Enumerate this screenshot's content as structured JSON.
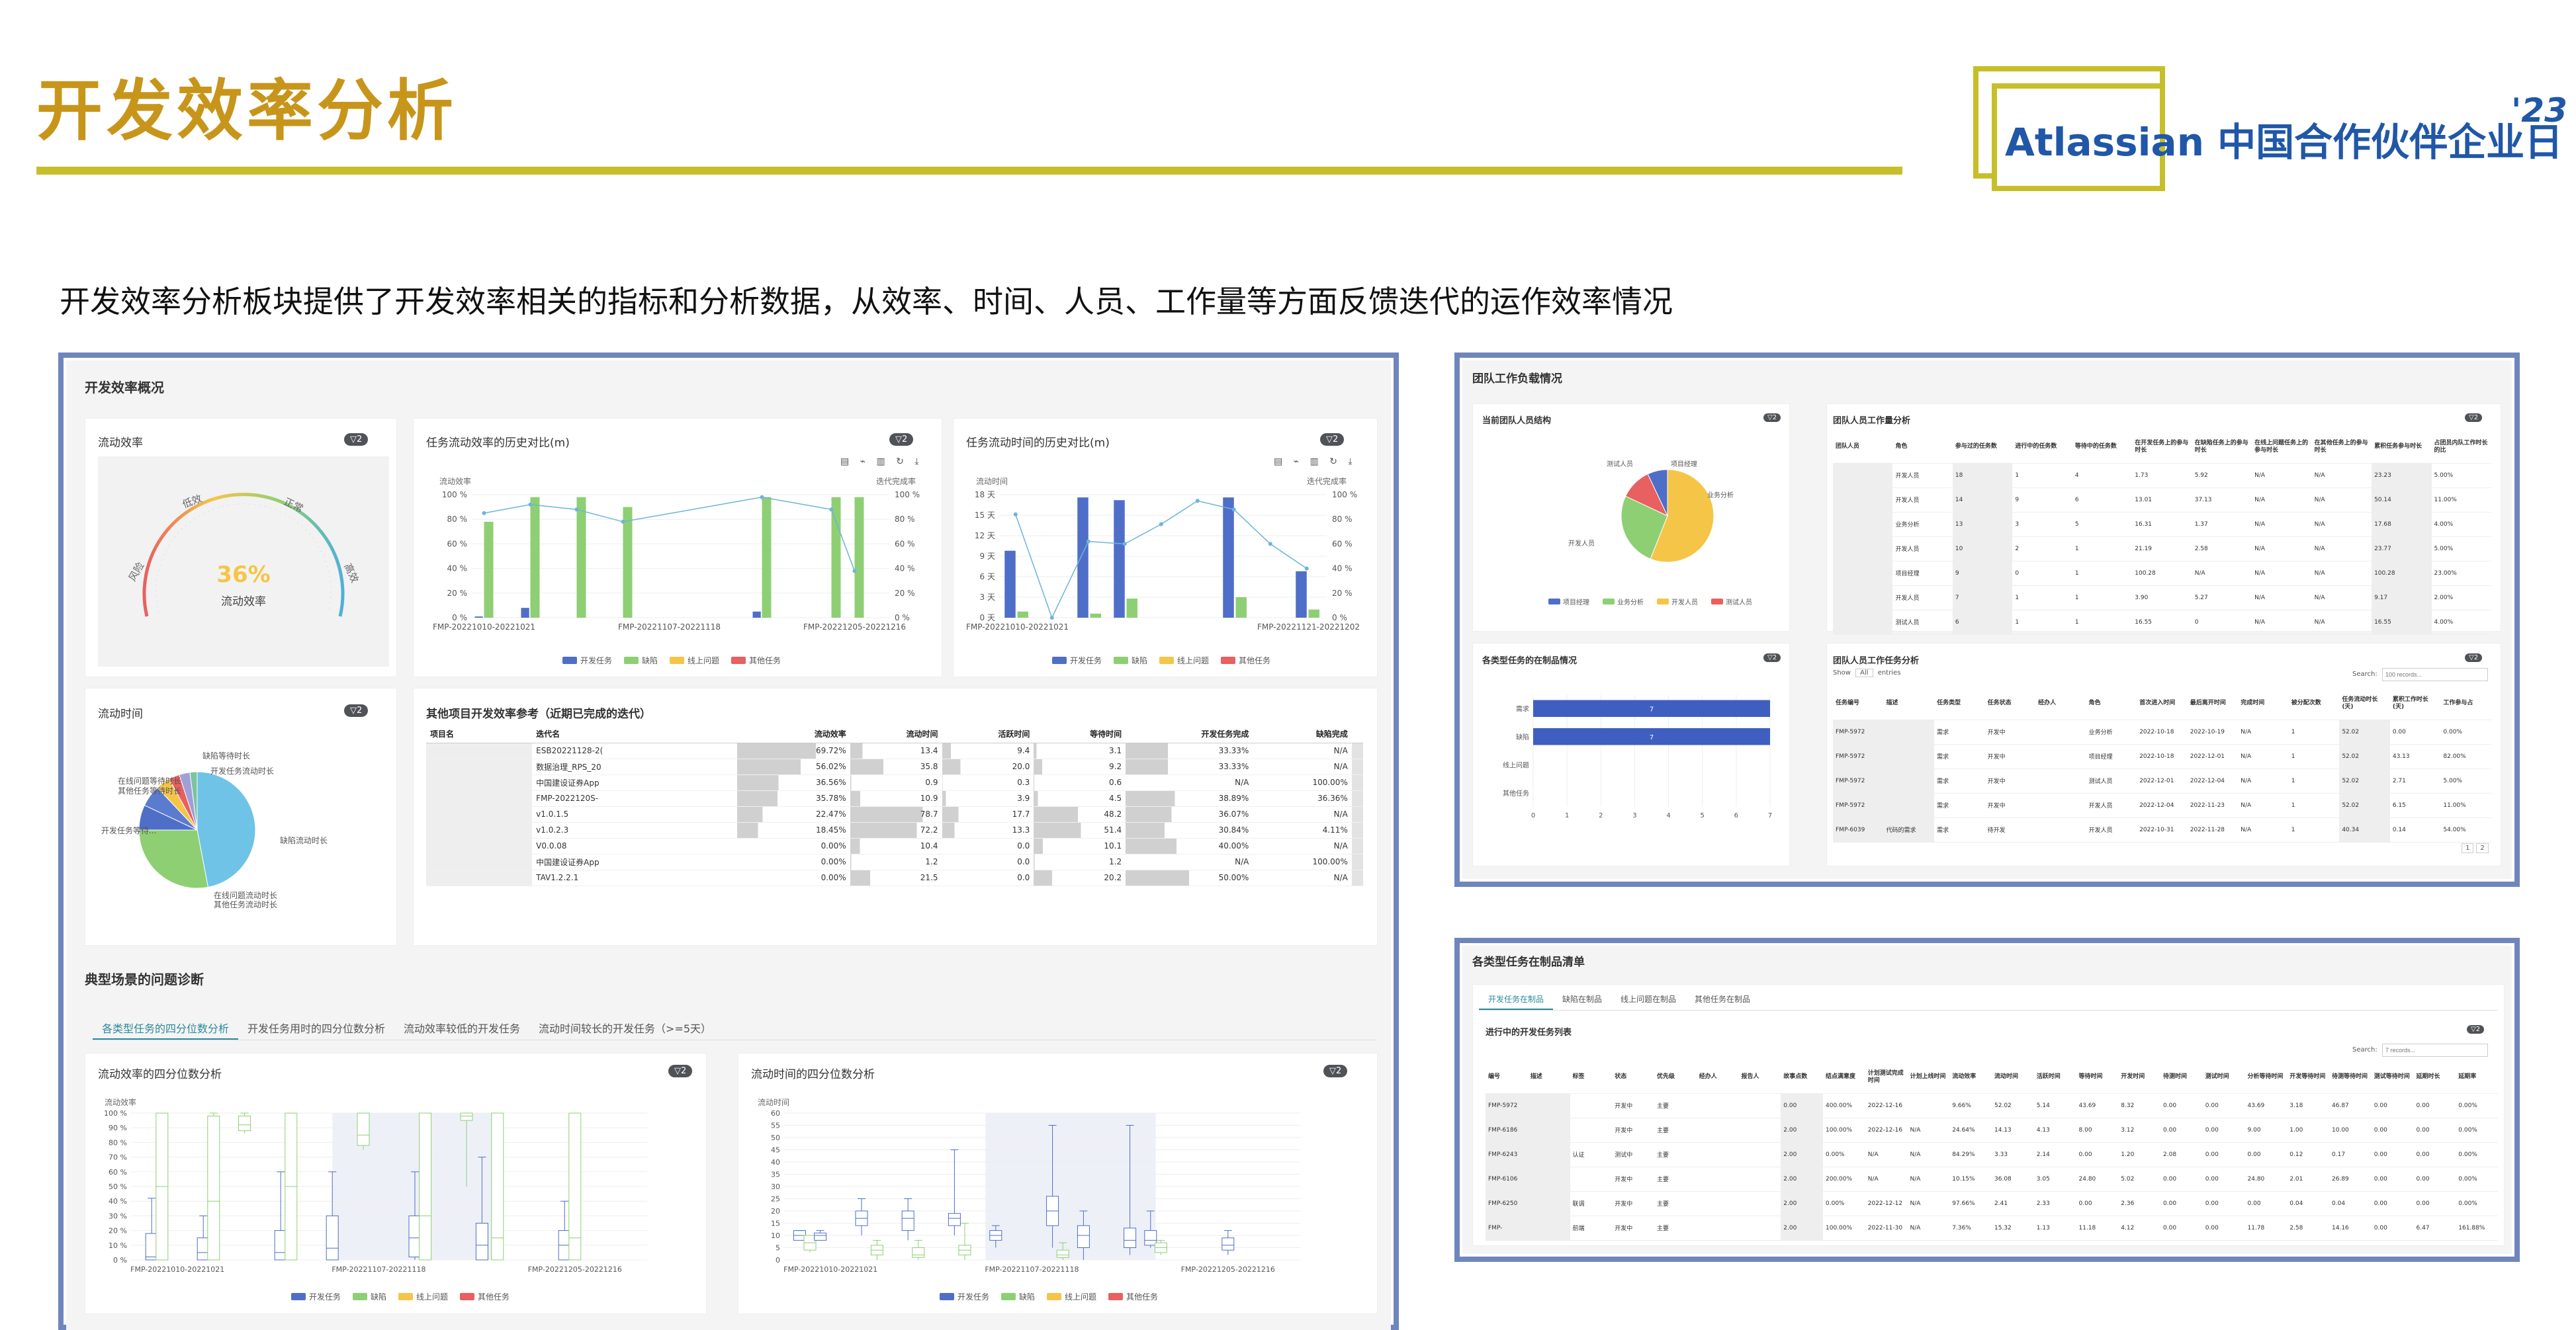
{
  "slide": {
    "title": "开发效率分析",
    "subtitle": "开发效率分析板块提供了开发效率相关的指标和分析数据，从效率、时间、人员、工作量等方面反馈迭代的运作效率情况",
    "logo": "Atlassian 中国合作伙伴企业日",
    "logo_year": "'23"
  },
  "colors": {
    "accent": "#c8951b",
    "frame": "#6f86bd",
    "blue": "#4f6ec8",
    "green": "#8ecf74",
    "yellow": "#f5c548",
    "red": "#e86060",
    "teal": "#2a8a9a"
  },
  "left": {
    "section": "开发效率概况",
    "gauge": {
      "title": "流动效率",
      "badge": "▽2",
      "value": "36%",
      "value_num": 36,
      "label": "流动效率",
      "zones": [
        "风险",
        "低效",
        "正常",
        "高效"
      ]
    },
    "hist_eff": {
      "title": "任务流动效率的历史对比(m)",
      "badge": "▽2",
      "yaxis_left": "流动效率",
      "yaxis_right": "迭代完成率",
      "ticks": [
        "100 %",
        "80 %",
        "60 %",
        "40 %",
        "20 %",
        "0 %"
      ],
      "xlabels": [
        "FMP-20221010-20221021",
        "FMP-20221107-20221118",
        "FMP-20221205-20221216"
      ]
    },
    "hist_time": {
      "title": "任务流动时间的历史对比(m)",
      "badge": "▽2",
      "yaxis_left": "流动时间",
      "yaxis_right": "迭代完成率",
      "ticks_left": [
        "18 天",
        "15 天",
        "12 天",
        "9 天",
        "6 天",
        "3 天",
        "0 天"
      ],
      "ticks_right": [
        "100 %",
        "80 %",
        "60 %",
        "40 %",
        "20 %",
        "0 %"
      ],
      "xlabels": [
        "FMP-20221010-20221021",
        "FMP-20221121-20221202"
      ]
    },
    "legend": [
      "开发任务",
      "缺陷",
      "线上问题",
      "其他任务"
    ],
    "pie": {
      "title": "流动时间",
      "badge": "▽2",
      "labels": [
        "缺陷等待时长",
        "开发任务流动时长",
        "在线问题等待时长",
        "其他任务等待时长",
        "开发任务等待...",
        "缺陷流动时长",
        "在线问题流动时长",
        "其他任务流动时长"
      ]
    },
    "ref_table": {
      "title": "其他项目开发效率参考（近期已完成的迭代）",
      "headers": [
        "项目名",
        "迭代名",
        "流动效率",
        "流动时间",
        "活跃时间",
        "等待时间",
        "开发任务完成",
        "缺陷完成"
      ],
      "rows": [
        [
          "",
          "ESB20221128-2(",
          "69.72%",
          "13.4",
          "9.4",
          "3.1",
          "33.33%",
          "N/A"
        ],
        [
          "",
          "数据治理_RPS_20",
          "56.02%",
          "35.8",
          "20.0",
          "9.2",
          "33.33%",
          "N/A"
        ],
        [
          "",
          "中国建设证券App",
          "36.56%",
          "0.9",
          "0.3",
          "0.6",
          "N/A",
          "100.00%"
        ],
        [
          "",
          "FMP-2022120S-",
          "35.78%",
          "10.9",
          "3.9",
          "4.5",
          "38.89%",
          "36.36%"
        ],
        [
          "",
          "v1.0.1.5",
          "22.47%",
          "78.7",
          "17.7",
          "48.2",
          "36.07%",
          "N/A"
        ],
        [
          "",
          "v1.0.2.3",
          "18.45%",
          "72.2",
          "13.3",
          "51.4",
          "30.84%",
          "4.11%"
        ],
        [
          "",
          "V0.0.08",
          "0.00%",
          "10.4",
          "0.0",
          "10.1",
          "40.00%",
          "N/A"
        ],
        [
          "",
          "中国建设证券App",
          "0.00%",
          "1.2",
          "0.0",
          "1.2",
          "N/A",
          "100.00%"
        ],
        [
          "",
          "TAV1.2.2.1",
          "0.00%",
          "21.5",
          "0.0",
          "20.2",
          "50.00%",
          "N/A"
        ]
      ]
    },
    "diag": {
      "section": "典型场景的问题诊断",
      "tabs": [
        "各类型任务的四分位数分析",
        "开发任务用时的四分位数分析",
        "流动效率较低的开发任务",
        "流动时间较长的开发任务（>=5天）"
      ],
      "box_eff": {
        "title": "流动效率的四分位数分析",
        "badge": "▽2",
        "ylabel": "流动效率",
        "ticks": [
          "100 %",
          "90 %",
          "80 %",
          "70 %",
          "60 %",
          "50 %",
          "40 %",
          "30 %",
          "20 %",
          "10 %",
          "0 %"
        ],
        "xlabels": [
          "FMP-20221010-20221021",
          "FMP-20221107-20221118",
          "FMP-20221205-20221216"
        ]
      },
      "box_time": {
        "title": "流动时间的四分位数分析",
        "badge": "▽2",
        "ylabel": "流动时间",
        "ticks": [
          "60",
          "55",
          "50",
          "45",
          "40",
          "35",
          "30",
          "25",
          "20",
          "15",
          "10",
          "5",
          "0"
        ],
        "xlabels": [
          "FMP-20221010-20221021",
          "FMP-20221107-20221118",
          "FMP-20221205-20221216"
        ]
      }
    }
  },
  "team": {
    "section": "团队工作负载情况",
    "structure": {
      "title": "当前团队人员结构",
      "badge": "▽2",
      "labels": [
        "测试人员",
        "项目经理",
        "业务分析",
        "开发人员"
      ],
      "legend": [
        "项目经理",
        "业务分析",
        "开发人员",
        "测试人员"
      ]
    },
    "work": {
      "title": "团队人员工作量分析",
      "badge": "▽2",
      "headers": [
        "团队人员",
        "角色",
        "参与过的任务数",
        "进行中的任务数",
        "等待中的任务数",
        "在开发任务上的参与时长",
        "在缺陷任务上的参与时长",
        "在线上问题任务上的参与时长",
        "在其他任务上的参与时长",
        "累积任务参与时长",
        "占团员内队工作时长的比"
      ],
      "rows": [
        [
          "",
          "开发人员",
          "18",
          "1",
          "4",
          "1.73",
          "5.92",
          "N/A",
          "N/A",
          "23.23",
          "5.00%"
        ],
        [
          "",
          "开发人员",
          "14",
          "9",
          "6",
          "13.01",
          "37.13",
          "N/A",
          "N/A",
          "50.14",
          "11.00%"
        ],
        [
          "",
          "业务分析",
          "13",
          "3",
          "5",
          "16.31",
          "1.37",
          "N/A",
          "N/A",
          "17.68",
          "4.00%"
        ],
        [
          "",
          "开发人员",
          "10",
          "2",
          "1",
          "21.19",
          "2.58",
          "N/A",
          "N/A",
          "23.77",
          "5.00%"
        ],
        [
          "",
          "项目经理",
          "9",
          "0",
          "1",
          "100.28",
          "N/A",
          "N/A",
          "N/A",
          "100.28",
          "23.00%"
        ],
        [
          "",
          "开发人员",
          "7",
          "1",
          "1",
          "3.90",
          "5.27",
          "N/A",
          "N/A",
          "9.17",
          "2.00%"
        ],
        [
          "",
          "测试人员",
          "6",
          "1",
          "1",
          "16.55",
          "0",
          "N/A",
          "N/A",
          "16.55",
          "4.00%"
        ]
      ]
    },
    "wip": {
      "title": "各类型任务的在制品情况",
      "badge": "▽2",
      "categories": [
        "需求",
        "缺陷",
        "线上问题",
        "其他任务"
      ],
      "values": [
        7,
        7,
        0,
        0
      ],
      "ticks": [
        "0",
        "1",
        "2",
        "3",
        "4",
        "5",
        "6",
        "7"
      ]
    },
    "detail": {
      "title": "团队人员工作任务分析",
      "badge": "▽2",
      "show": "Show",
      "entries": "entries",
      "all": "All",
      "search": "Search:",
      "search_ph": "100 records...",
      "headers": [
        "任务编号",
        "描述",
        "任务类型",
        "任务状态",
        "经办人",
        "角色",
        "首次进入时间",
        "最后离开时间",
        "完成时间",
        "被分配次数",
        "任务流动时长(天)",
        "累积工作时长(天)",
        "工作参与占"
      ],
      "rows": [
        [
          "FMP-5972",
          "",
          "需求",
          "开发中",
          "",
          "业务分析",
          "2022-10-18",
          "2022-10-19",
          "N/A",
          "1",
          "52.02",
          "0.00",
          "0.00%"
        ],
        [
          "FMP-5972",
          "",
          "需求",
          "开发中",
          "",
          "项目经理",
          "2022-10-18",
          "2022-12-01",
          "N/A",
          "1",
          "52.02",
          "43.13",
          "82.00%"
        ],
        [
          "FMP-5972",
          "",
          "需求",
          "开发中",
          "",
          "测试人员",
          "2022-12-01",
          "2022-12-04",
          "N/A",
          "1",
          "52.02",
          "2.71",
          "5.00%"
        ],
        [
          "FMP-5972",
          "",
          "需求",
          "开发中",
          "",
          "开发人员",
          "2022-12-04",
          "2022-11-23",
          "N/A",
          "1",
          "52.02",
          "6.15",
          "11.00%"
        ],
        [
          "FMP-6039",
          "代码的需求",
          "需求",
          "待开发",
          "",
          "开发人员",
          "2022-10-31",
          "2022-11-28",
          "N/A",
          "1",
          "40.34",
          "0.14",
          "54.00%"
        ]
      ]
    },
    "pager": [
      "1",
      "2"
    ]
  },
  "wip_list": {
    "section": "各类型任务在制品清单",
    "tabs": [
      "开发任务在制品",
      "缺陷在制品",
      "线上问题在制品",
      "其他任务在制品"
    ],
    "title": "进行中的开发任务列表",
    "badge": "▽2",
    "search": "Search:",
    "search_ph": "7 records...",
    "headers": [
      "编号",
      "描述",
      "标签",
      "状态",
      "优先级",
      "经办人",
      "报告人",
      "故事点数",
      "结点满意度",
      "计划测试完成时间",
      "计划上线时间",
      "流动效率",
      "流动时间",
      "活跃时间",
      "等待时间",
      "开发时间",
      "待测时间",
      "测试时间",
      "分析等待时间",
      "开发等待时间",
      "待测等待时间",
      "测试等待时间",
      "延期时长",
      "延期率"
    ],
    "rows": [
      [
        "FMP-5972",
        "",
        "",
        "开发中",
        "主要",
        "",
        "",
        "0.00",
        "400.00%",
        "2022-12-16",
        "",
        "9.66%",
        "52.02",
        "5.14",
        "43.69",
        "8.32",
        "0.00",
        "0.00",
        "43.69",
        "3.18",
        "46.87",
        "0.00",
        "0.00",
        "0.00%"
      ],
      [
        "FMP-6186",
        "",
        "",
        "开发中",
        "主要",
        "",
        "",
        "2.00",
        "100.00%",
        "2022-12-16",
        "N/A",
        "24.64%",
        "14.13",
        "4.13",
        "8.00",
        "3.12",
        "0.00",
        "0.00",
        "9.00",
        "1.00",
        "10.00",
        "0.00",
        "0.00",
        "0.00%"
      ],
      [
        "FMP-6243",
        "",
        "认证",
        "测试中",
        "主要",
        "",
        "",
        "2.00",
        "0.00%",
        "N/A",
        "N/A",
        "84.29%",
        "3.33",
        "2.14",
        "0.00",
        "1.20",
        "2.08",
        "0.00",
        "0.00",
        "0.12",
        "0.17",
        "0.00",
        "0.00",
        "0.00%"
      ],
      [
        "FMP-6106",
        "",
        "",
        "开发中",
        "主要",
        "",
        "",
        "2.00",
        "200.00%",
        "N/A",
        "N/A",
        "10.15%",
        "36.08",
        "3.05",
        "24.80",
        "5.02",
        "0.00",
        "0.00",
        "24.80",
        "2.01",
        "26.89",
        "0.00",
        "0.00",
        "0.00%"
      ],
      [
        "FMP-6250",
        "",
        "联调",
        "开发中",
        "主要",
        "",
        "",
        "2.00",
        "0.00%",
        "2022-12-12",
        "N/A",
        "97.66%",
        "2.41",
        "2.33",
        "0.00",
        "2.36",
        "0.00",
        "0.00",
        "0.00",
        "0.04",
        "0.04",
        "0.00",
        "0.00",
        "0.00%"
      ],
      [
        "FMP-",
        "",
        "前端",
        "开发中",
        "主要",
        "",
        "",
        "2.00",
        "100.00%",
        "2022-11-30",
        "N/A",
        "7.36%",
        "15.32",
        "1.13",
        "11.18",
        "4.12",
        "0.00",
        "0.00",
        "11.78",
        "2.58",
        "14.16",
        "0.00",
        "6.47",
        "161.88%"
      ]
    ]
  },
  "chart_data": [
    {
      "type": "gauge",
      "title": "流动效率",
      "value": 36,
      "range": [
        0,
        100
      ]
    },
    {
      "type": "bar",
      "title": "任务流动效率的历史对比(m)",
      "categories": [
        "FMP-20221010-20221021",
        "",
        "",
        "",
        "",
        "",
        "",
        "",
        "FMP-20221107-20221118",
        "",
        "",
        "",
        "",
        "",
        "",
        "",
        "FMP-20221205-20221216",
        ""
      ],
      "series": [
        {
          "name": "开发任务",
          "values": [
            1,
            0,
            8,
            0,
            0,
            0,
            0,
            0,
            0,
            0,
            0,
            0,
            5,
            0,
            0,
            0,
            0,
            0
          ]
        },
        {
          "name": "缺陷",
          "values": [
            78,
            0,
            98,
            0,
            98,
            0,
            90,
            0,
            0,
            0,
            0,
            0,
            98,
            0,
            0,
            98,
            98,
            0
          ]
        },
        {
          "name": "线上问题",
          "values": []
        },
        {
          "name": "其他任务",
          "values": []
        }
      ],
      "line": [
        85,
        0,
        92,
        0,
        88,
        0,
        78,
        0,
        0,
        0,
        0,
        0,
        98,
        0,
        0,
        88,
        38,
        0
      ],
      "ylim": [
        0,
        100
      ]
    },
    {
      "type": "bar",
      "title": "任务流动时间的历史对比(m)",
      "categories": [
        "FMP-20221010-20221021",
        "",
        "",
        "",
        "",
        "",
        "",
        "",
        "FMP-20221121-20221202"
      ],
      "series": [
        {
          "name": "开发任务",
          "values": [
            9.8,
            0,
            17.6,
            17.2,
            0,
            0,
            17.6,
            0,
            6.8
          ]
        },
        {
          "name": "缺陷",
          "values": [
            0.9,
            0,
            0.6,
            2.8,
            0,
            0,
            3.0,
            0,
            1.2
          ]
        }
      ],
      "line": [
        84,
        0,
        62,
        60,
        76,
        95,
        88,
        60,
        40
      ],
      "ylim": [
        0,
        18
      ]
    },
    {
      "type": "pie",
      "title": "流动时间",
      "series": [
        {
          "name": "开发任务等待时长",
          "value": 47
        },
        {
          "name": "缺陷流动时长",
          "value": 28
        },
        {
          "name": "开发任务流动时长",
          "value": 7
        },
        {
          "name": "缺陷等待时长",
          "value": 6
        },
        {
          "name": "在线问题等待时长",
          "value": 4
        },
        {
          "name": "其他任务等待时长",
          "value": 3
        },
        {
          "name": "在线问题流动时长",
          "value": 3
        },
        {
          "name": "其他任务流动时长",
          "value": 2
        }
      ]
    },
    {
      "type": "pie",
      "title": "当前团队人员结构",
      "series": [
        {
          "name": "开发人员",
          "value": 56
        },
        {
          "name": "业务分析",
          "value": 26
        },
        {
          "name": "测试人员",
          "value": 11
        },
        {
          "name": "项目经理",
          "value": 7
        }
      ]
    },
    {
      "type": "bar",
      "title": "各类型任务的在制品情况",
      "categories": [
        "需求",
        "缺陷",
        "线上问题",
        "其他任务"
      ],
      "values": [
        7,
        7,
        0,
        0
      ],
      "xlim": [
        0,
        7
      ]
    }
  ]
}
